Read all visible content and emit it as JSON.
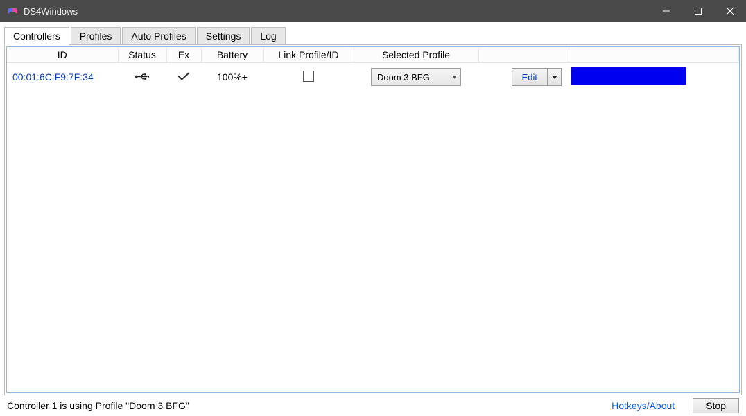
{
  "window": {
    "title": "DS4Windows"
  },
  "tabs": [
    "Controllers",
    "Profiles",
    "Auto Profiles",
    "Settings",
    "Log"
  ],
  "columns": [
    "ID",
    "Status",
    "Ex",
    "Battery",
    "Link Profile/ID",
    "Selected Profile",
    "",
    ""
  ],
  "row": {
    "id": "00:01:6C:F9:7F:34",
    "status_icon": "usb-icon",
    "ex_icon": "check-icon",
    "battery": "100%+",
    "link_checked": false,
    "selected_profile": "Doom 3 BFG",
    "edit_label": "Edit",
    "color_swatch": "#0000f0"
  },
  "statusbar": {
    "text": "Controller 1 is using Profile \"Doom 3 BFG\"",
    "link_label": "Hotkeys/About",
    "stop_label": "Stop"
  }
}
